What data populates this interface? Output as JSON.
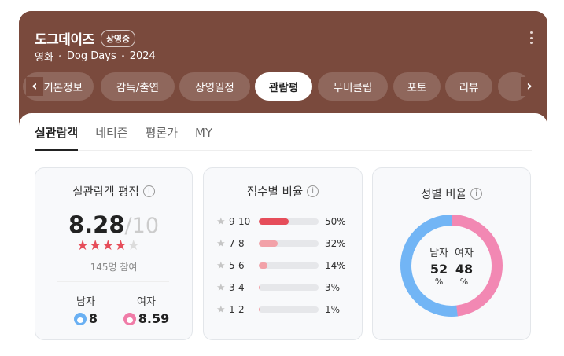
{
  "header": {
    "title": "도그데이즈",
    "badge": "상영중",
    "category": "영화",
    "english_title": "Dog Days",
    "year": "2024"
  },
  "tabs": [
    {
      "label": "기본정보",
      "active": false
    },
    {
      "label": "감독/출연",
      "active": false
    },
    {
      "label": "상영일정",
      "active": false
    },
    {
      "label": "관람평",
      "active": true
    },
    {
      "label": "무비클립",
      "active": false
    },
    {
      "label": "포토",
      "active": false
    },
    {
      "label": "리뷰",
      "active": false
    }
  ],
  "subtabs": [
    "실관람객",
    "네티즌",
    "평론가",
    "MY"
  ],
  "rating": {
    "title": "실관람객 평점",
    "score": "8.28",
    "max": "10",
    "stars_value": 4.14,
    "participants": "145명 참여",
    "male_label": "남자",
    "male_score": "8",
    "female_label": "여자",
    "female_score": "8.59"
  },
  "distribution": {
    "title": "점수별 비율",
    "rows": [
      {
        "range": "9-10",
        "pct_text": "50%",
        "value": 50,
        "color": "#e64d5a"
      },
      {
        "range": "7-8",
        "pct_text": "32%",
        "value": 32,
        "color": "#f2a1a8"
      },
      {
        "range": "5-6",
        "pct_text": "14%",
        "value": 14,
        "color": "#f2a1a8"
      },
      {
        "range": "3-4",
        "pct_text": "3%",
        "value": 3,
        "color": "#f2a1a8"
      },
      {
        "range": "1-2",
        "pct_text": "1%",
        "value": 1,
        "color": "#f2a1a8"
      }
    ]
  },
  "gender": {
    "title": "성별 비율",
    "male_label": "남자",
    "female_label": "여자",
    "male_pct": "52",
    "female_pct": "48",
    "unit": "%",
    "male_color": "#72b5f5",
    "female_color": "#f288b3"
  },
  "icons": {
    "prev": "chevron-left-icon",
    "next": "chevron-right-icon",
    "more": "more-vertical-icon",
    "info": "info-icon",
    "star": "star-icon"
  },
  "colors": {
    "header_bg": "#7a4a3d",
    "star": "#e64d5a"
  }
}
